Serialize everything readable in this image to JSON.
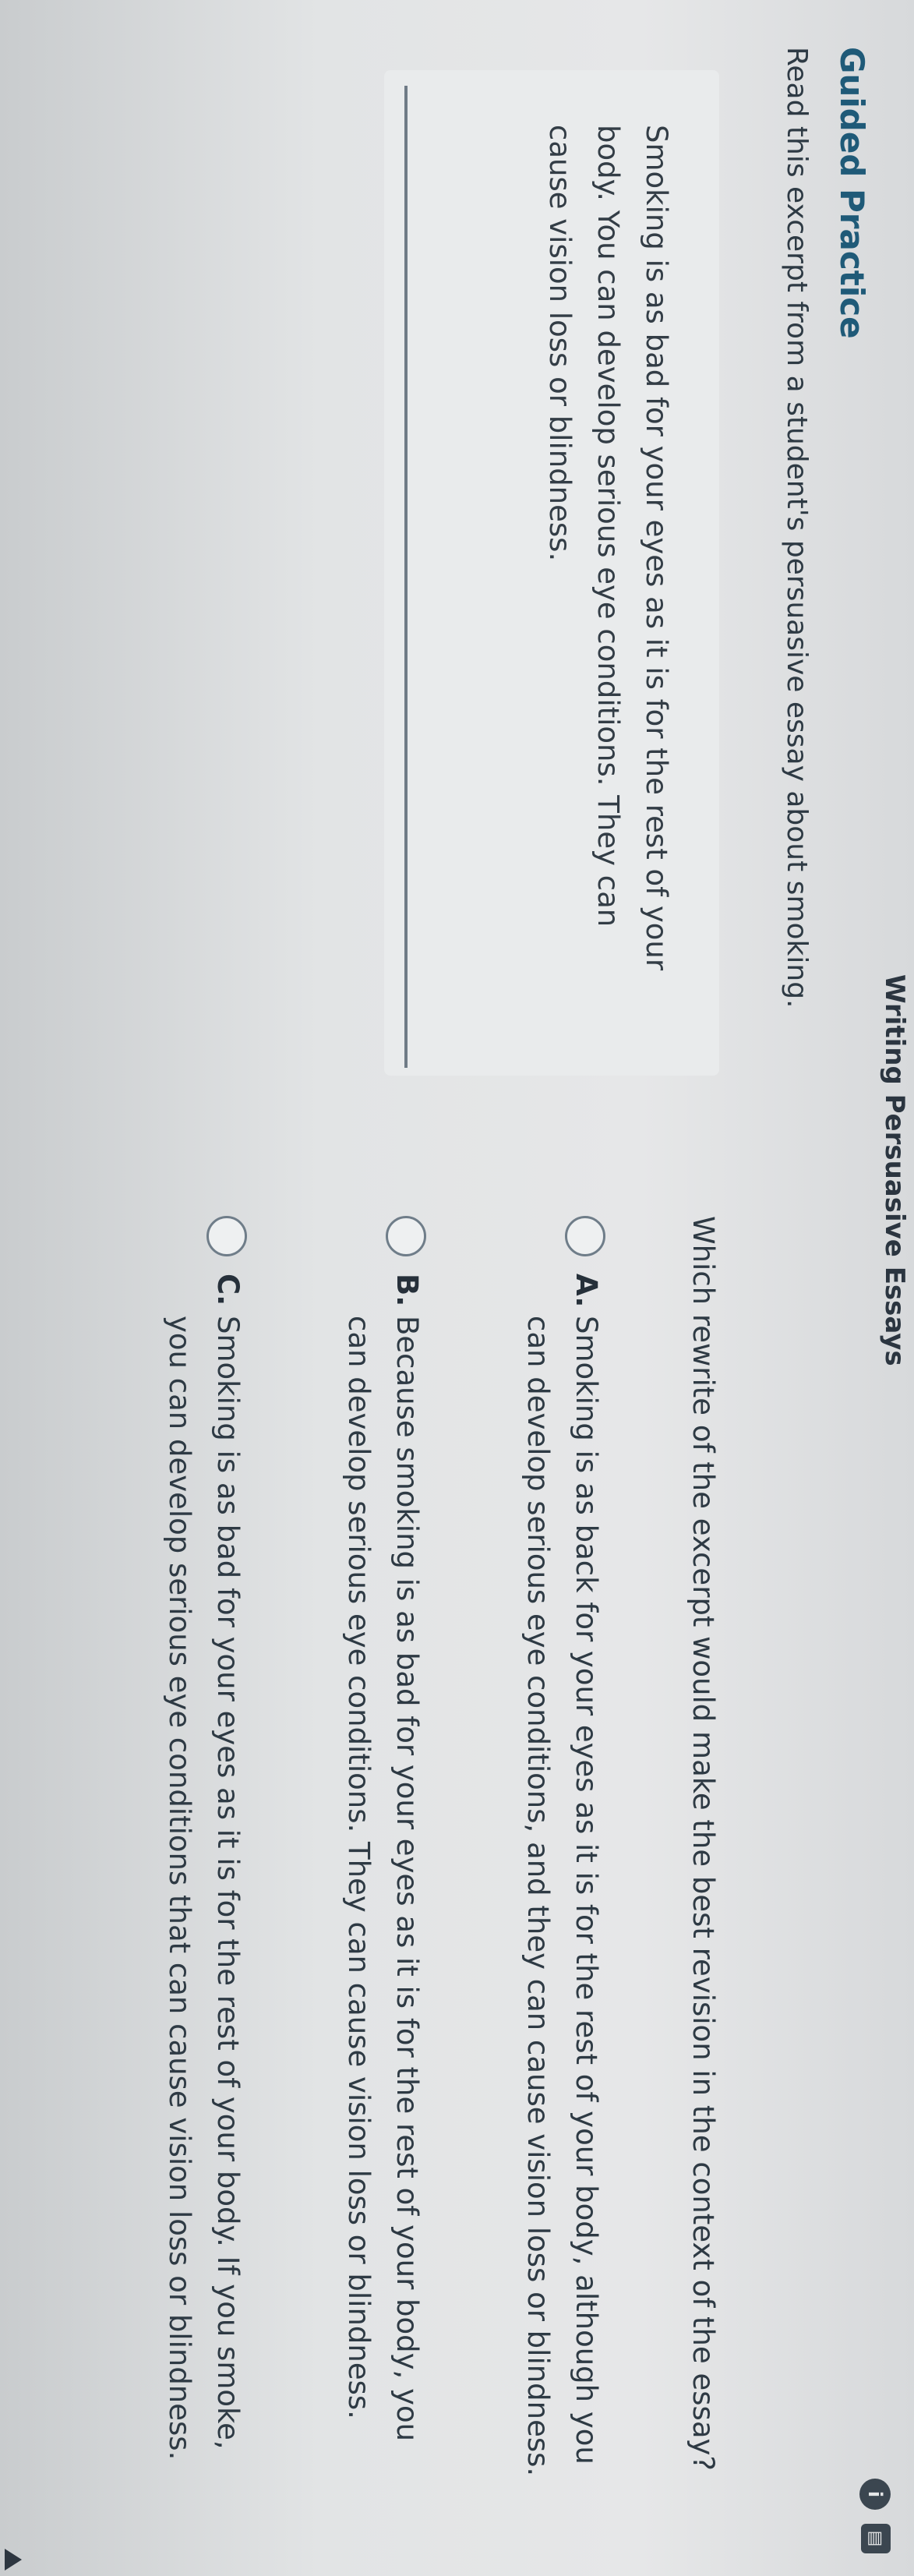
{
  "header": {
    "title": "Writing Persuasive Essays",
    "info_icon": "info-icon",
    "glossary_icon": "book-icon"
  },
  "section": {
    "title": "Guided Practice",
    "instruction": "Read this excerpt from a student's persuasive essay about smoking."
  },
  "excerpt": {
    "text": "Smoking is as bad for your eyes as it is for the rest of your body. You can develop serious eye conditions. They can cause vision loss or blindness."
  },
  "question": {
    "prompt": "Which rewrite of the excerpt would make the best revision in the context of the essay?",
    "options": [
      {
        "letter": "A.",
        "text": "Smoking is as back for your eyes as it is for the rest of your body, although you can develop serious eye conditions, and they can cause vision loss or blindness."
      },
      {
        "letter": "B.",
        "text": "Because smoking is as bad for your eyes as it is for the rest of your body, you can develop serious eye conditions. They can cause vision loss or blindness."
      },
      {
        "letter": "C.",
        "text": "Smoking is as bad for your eyes as it is for the rest of your body. If you smoke, you can develop serious eye conditions that can cause vision loss or blindness."
      }
    ]
  },
  "colors": {
    "accent": "#1f5a78",
    "text": "#2e3a44"
  }
}
